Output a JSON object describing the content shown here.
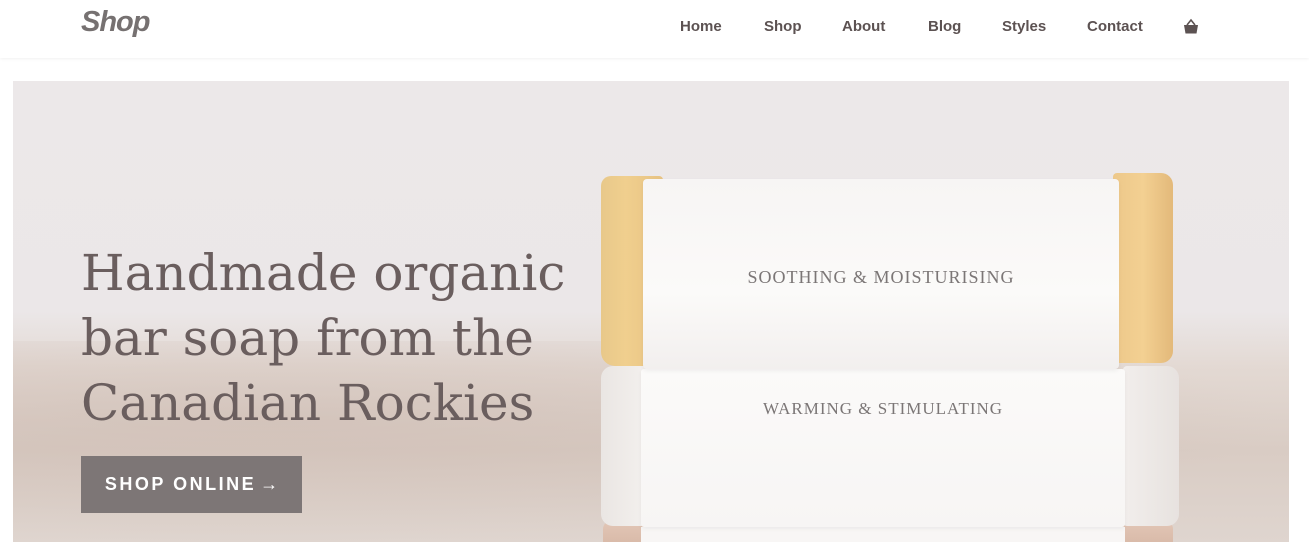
{
  "header": {
    "logo": "Shop",
    "nav": [
      {
        "label": "Home"
      },
      {
        "label": "Shop"
      },
      {
        "label": "About"
      },
      {
        "label": "Blog"
      },
      {
        "label": "Styles"
      },
      {
        "label": "Contact"
      }
    ],
    "cart_icon": "shopping-basket-icon"
  },
  "hero": {
    "headline_lines": [
      "Handmade organic",
      "bar soap from the",
      "Canadian Rockies"
    ],
    "cta_label": "SHOP ONLINE",
    "cta_arrow": "→",
    "soap_labels": [
      "SOOTHING & MOISTURISING",
      "WARMING & STIMULATING"
    ]
  },
  "colors": {
    "brand_text": "#6a5e5e",
    "logo": "#767171",
    "cta_background": "#7d7676",
    "nav_text": "#5c5252"
  }
}
